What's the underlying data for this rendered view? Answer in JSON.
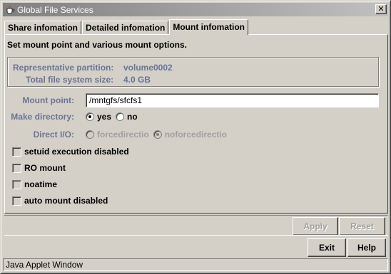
{
  "window": {
    "title": "Global File Services",
    "close_glyph": "✕",
    "icon": "java-coffee-icon"
  },
  "tabs": [
    {
      "label": "Share infomation",
      "active": false
    },
    {
      "label": "Detailed infomation",
      "active": false
    },
    {
      "label": "Mount infomation",
      "active": true
    }
  ],
  "instruction": "Set mount point and various mount options.",
  "representative": {
    "partition_label": "Representative partition:",
    "partition_value": "volume0002",
    "size_label": "Total file system size:",
    "size_value": "4.0 GB"
  },
  "mount_point": {
    "label": "Mount point:",
    "value": "/mntgfs/sfcfs1"
  },
  "make_directory": {
    "label": "Make directory:",
    "options": [
      {
        "label": "yes",
        "checked": true
      },
      {
        "label": "no",
        "checked": false
      }
    ]
  },
  "direct_io": {
    "label": "Direct I/O:",
    "options": [
      {
        "label": "forcedirectio",
        "checked": false
      },
      {
        "label": "noforcedirectio",
        "checked": true
      }
    ]
  },
  "options": [
    {
      "label": "setuid execution disabled",
      "checked": false
    },
    {
      "label": "RO mount",
      "checked": false
    },
    {
      "label": "noatime",
      "checked": false
    },
    {
      "label": "auto mount disabled",
      "checked": false
    }
  ],
  "buttons": {
    "apply": "Apply",
    "reset": "Reset",
    "exit": "Exit",
    "help": "Help"
  },
  "status": "Java Applet Window",
  "colors": {
    "face": "#d4d0c8",
    "label_grey_blue": "#6b7497",
    "disabled": "#a0a0a0"
  }
}
